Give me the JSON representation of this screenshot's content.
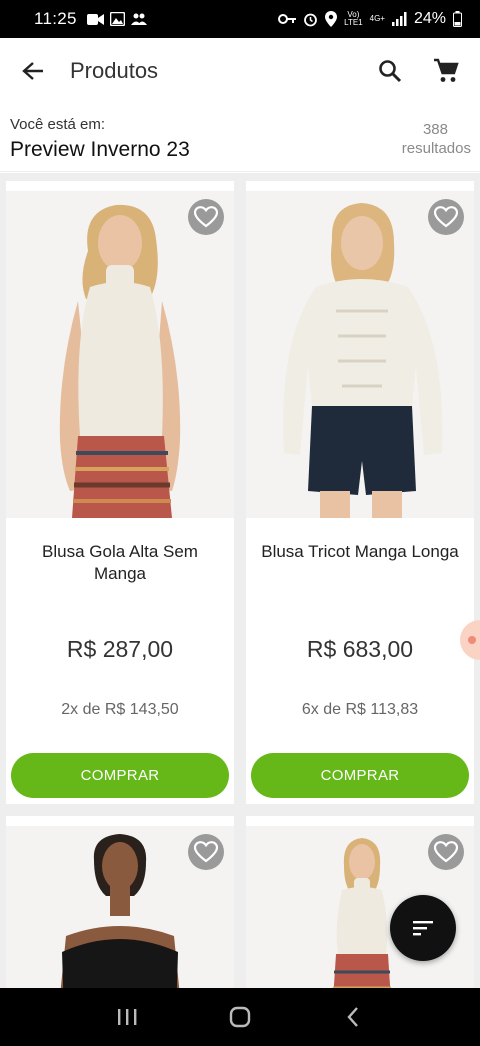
{
  "status_bar": {
    "time": "11:25",
    "battery": "24%",
    "network_top": "Vo)",
    "network_bottom": "LTE1",
    "signal_type": "4G+"
  },
  "app_bar": {
    "title": "Produtos",
    "back_icon": "arrow-left-icon",
    "search_icon": "search-icon",
    "cart_icon": "cart-icon"
  },
  "context": {
    "label": "Você está em:",
    "collection": "Preview Inverno 23",
    "result_count": "388",
    "result_label": "resultados"
  },
  "products": [
    {
      "name": "Blusa Gola Alta Sem Manga",
      "price": "R$  287,00",
      "installments": "2x de R$  143,50",
      "buy_label": "COMPRAR"
    },
    {
      "name": "Blusa Tricot Manga Longa",
      "price": "R$  683,00",
      "installments": "6x de R$  113,83",
      "buy_label": "COMPRAR"
    }
  ],
  "colors": {
    "buy_button": "#66b718",
    "favorite_bg": "#9a9a9a",
    "fab": "#111111"
  }
}
